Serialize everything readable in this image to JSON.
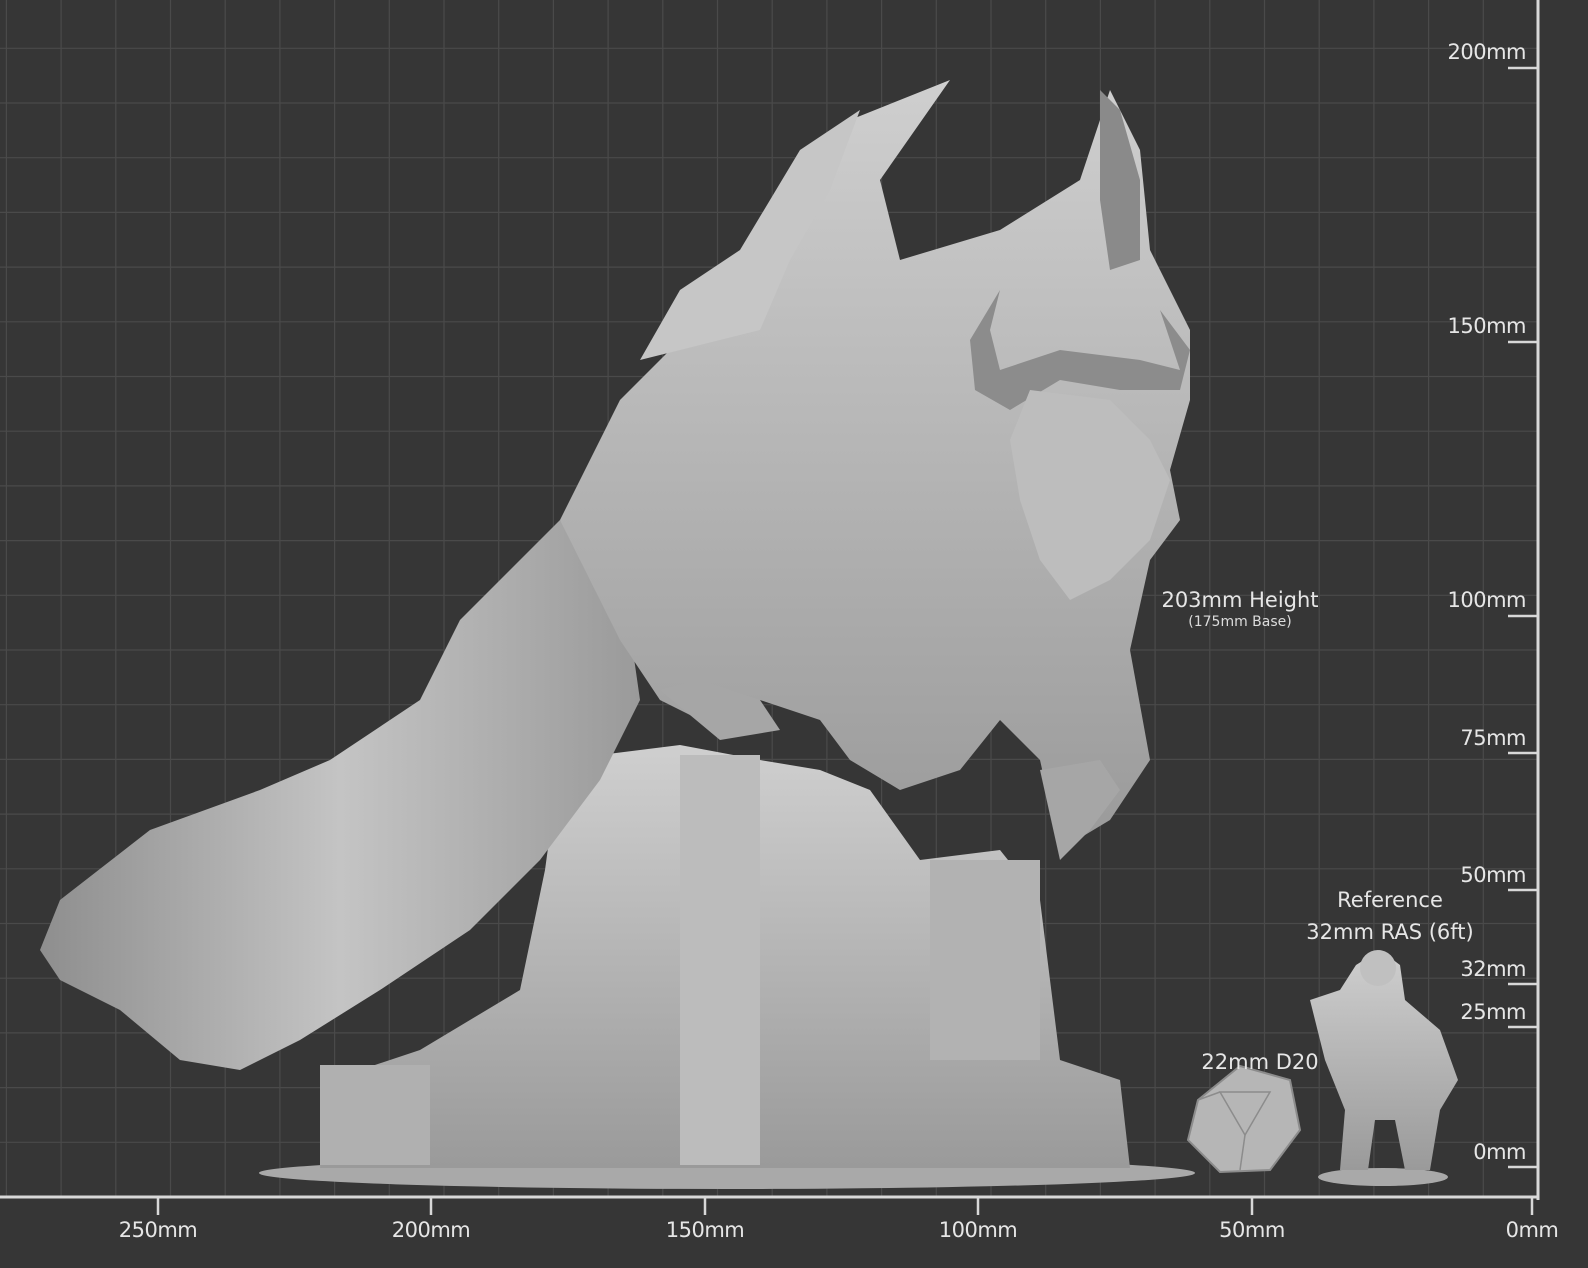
{
  "scale": {
    "y_labels": [
      "200mm",
      "150mm",
      "100mm",
      "75mm",
      "50mm",
      "32mm",
      "25mm",
      "0mm"
    ],
    "x_labels": [
      "250mm",
      "200mm",
      "150mm",
      "100mm",
      "50mm",
      "0mm"
    ]
  },
  "annotations": {
    "height": "203mm Height",
    "base": "(175mm Base)",
    "dice": "22mm D20",
    "reference_line1": "Reference",
    "reference_line2": "32mm RAS (6ft)"
  },
  "colors": {
    "background": "#363636",
    "grid": "#4a4a4a",
    "ruler": "#d8d8d8",
    "model": "#b8b8b8"
  }
}
